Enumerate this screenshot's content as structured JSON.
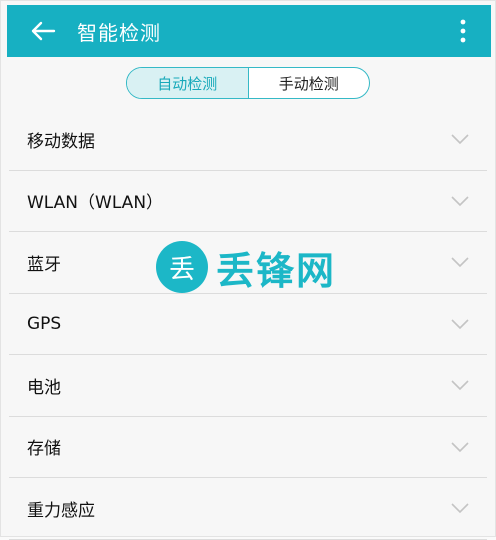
{
  "appbar": {
    "title": "智能检测",
    "back_icon": "arrow-left-icon",
    "more_icon": "more-vertical-icon",
    "color": "#17b0c2"
  },
  "tabs": [
    {
      "label": "自动检测",
      "active": true
    },
    {
      "label": "手动检测",
      "active": false
    }
  ],
  "items": [
    {
      "label": "移动数据"
    },
    {
      "label": "WLAN（WLAN）"
    },
    {
      "label": "蓝牙"
    },
    {
      "label": "GPS"
    },
    {
      "label": "电池"
    },
    {
      "label": "存储"
    },
    {
      "label": "重力感应"
    }
  ],
  "watermark": {
    "logo_char": "丢",
    "text": "丢锋网"
  }
}
